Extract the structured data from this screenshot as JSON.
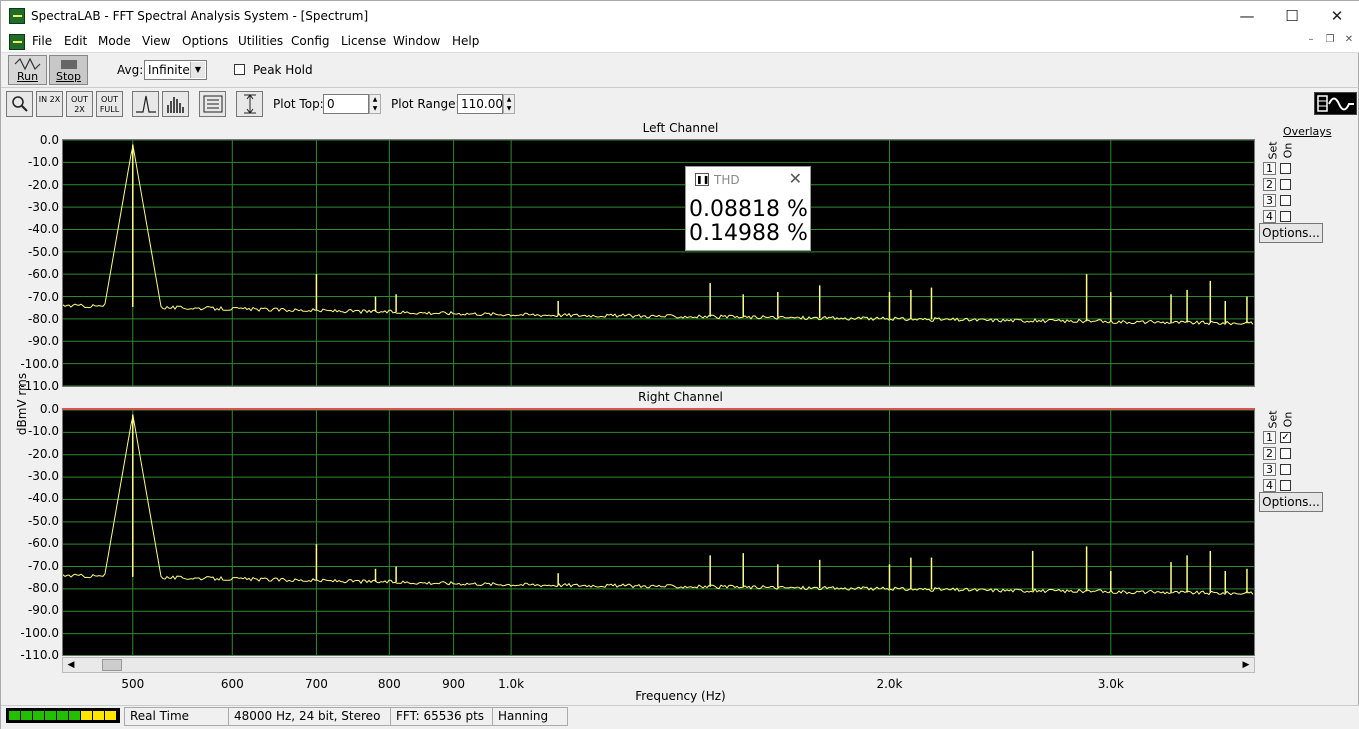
{
  "window": {
    "title": "SpectraLAB - FFT Spectral Analysis System - [Spectrum]",
    "min": "—",
    "max": "☐",
    "close": "✕"
  },
  "menu": [
    "File",
    "Edit",
    "Mode",
    "View",
    "Options",
    "Utilities",
    "Config",
    "License",
    "Window",
    "Help"
  ],
  "mdi": {
    "min": "–",
    "restore": "❐",
    "close": "✕"
  },
  "toolbar": {
    "run": "Run",
    "stop": "Stop",
    "avg_label": "Avg:",
    "avg_value": "Infinite",
    "peak_hold": "Peak Hold",
    "plot_top_label": "Plot Top:",
    "plot_top_value": "0",
    "plot_range_label": "Plot Range:",
    "plot_range_value": "110.00",
    "zoom_in": "IN 2X",
    "zoom_out": "OUT 2X",
    "zoom_full": "OUT FULL"
  },
  "channels": {
    "left": "Left Channel",
    "right": "Right Channel"
  },
  "y_axis_label": "dBmV rms",
  "x_axis_label": "Frequency (Hz)",
  "y_ticks": [
    "0.0",
    "-10.0",
    "-20.0",
    "-30.0",
    "-40.0",
    "-50.0",
    "-60.0",
    "-70.0",
    "-80.0",
    "-90.0",
    "-100.0",
    "-110.0"
  ],
  "x_ticks": [
    "500",
    "600",
    "700",
    "800",
    "900",
    "1.0k",
    "2.0k",
    "3.0k"
  ],
  "overlays": {
    "title": "Overlays",
    "set": "Set",
    "on": "On",
    "options": "Options...",
    "items": [
      "1",
      "2",
      "3",
      "4"
    ],
    "right_checked": [
      true,
      false,
      false,
      false
    ]
  },
  "thd": {
    "title": "THD",
    "left": "0.08818 %",
    "right": "0.14988 %"
  },
  "status": {
    "mode": "Real Time",
    "format": "48000 Hz, 24 bit, Stereo",
    "fft": "FFT: 65536 pts",
    "window": "Hanning"
  },
  "colors": {
    "trace": "#ffff80",
    "grid": "#2f8a2f",
    "plot_bg": "#000000"
  },
  "chart_data": [
    {
      "type": "line",
      "title": "Left Channel",
      "xlabel": "Frequency (Hz)",
      "ylabel": "dBmV rms",
      "xscale": "log",
      "xlim": [
        440,
        3900
      ],
      "ylim": [
        -110,
        0
      ],
      "x_ticks": [
        500,
        600,
        700,
        800,
        900,
        1000,
        2000,
        3000
      ],
      "noise_floor": [
        [
          440,
          -74
        ],
        [
          1000,
          -78
        ],
        [
          2000,
          -80
        ],
        [
          3900,
          -82
        ]
      ],
      "peaks": [
        [
          500,
          -2
        ],
        [
          700,
          -60
        ],
        [
          780,
          -70
        ],
        [
          810,
          -69
        ],
        [
          1090,
          -72
        ],
        [
          1440,
          -64
        ],
        [
          1530,
          -69
        ],
        [
          1630,
          -68
        ],
        [
          1760,
          -65
        ],
        [
          2000,
          -68
        ],
        [
          2080,
          -67
        ],
        [
          2160,
          -66
        ],
        [
          2870,
          -60
        ],
        [
          3000,
          -68
        ],
        [
          3350,
          -69
        ],
        [
          3450,
          -67
        ],
        [
          3600,
          -63
        ],
        [
          3700,
          -72
        ],
        [
          3850,
          -70
        ]
      ]
    },
    {
      "type": "line",
      "title": "Right Channel",
      "xlabel": "Frequency (Hz)",
      "ylabel": "dBmV rms",
      "xscale": "log",
      "xlim": [
        440,
        3900
      ],
      "ylim": [
        -110,
        0
      ],
      "x_ticks": [
        500,
        600,
        700,
        800,
        900,
        1000,
        2000,
        3000
      ],
      "noise_floor": [
        [
          440,
          -74
        ],
        [
          1000,
          -78
        ],
        [
          2000,
          -80
        ],
        [
          3900,
          -82
        ]
      ],
      "peaks": [
        [
          500,
          -2
        ],
        [
          700,
          -60
        ],
        [
          780,
          -71
        ],
        [
          810,
          -70
        ],
        [
          1090,
          -73
        ],
        [
          1440,
          -65
        ],
        [
          1530,
          -64
        ],
        [
          1630,
          -69
        ],
        [
          1760,
          -67
        ],
        [
          2000,
          -69
        ],
        [
          2080,
          -66
        ],
        [
          2160,
          -66
        ],
        [
          2600,
          -63
        ],
        [
          2870,
          -61
        ],
        [
          3000,
          -72
        ],
        [
          3350,
          -68
        ],
        [
          3450,
          -65
        ],
        [
          3600,
          -63
        ],
        [
          3700,
          -72
        ],
        [
          3850,
          -71
        ]
      ]
    }
  ]
}
